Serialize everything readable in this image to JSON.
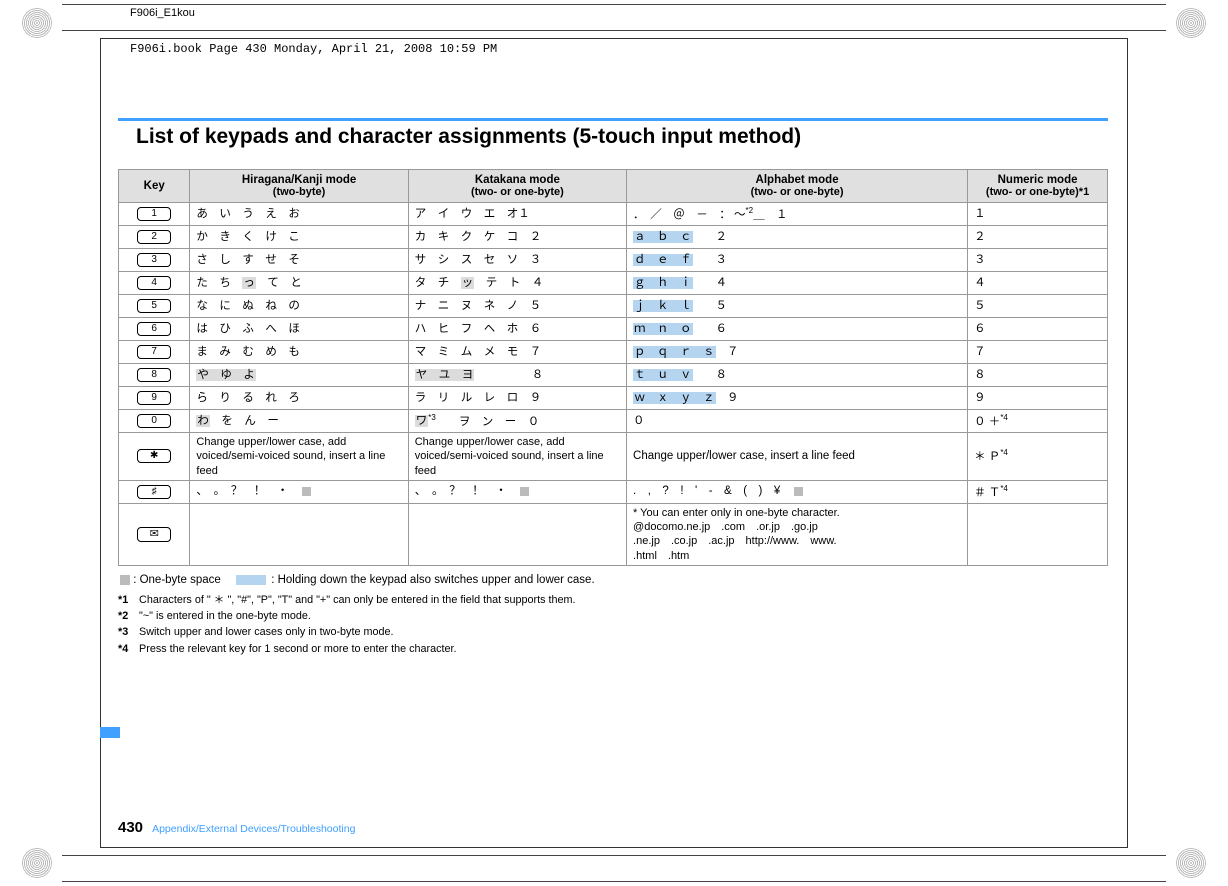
{
  "header_text": "F906i_E1kou",
  "book_info": "F906i.book  Page 430  Monday, April 21, 2008  10:59 PM",
  "title": "List of keypads and character assignments (5-touch input method)",
  "columns": {
    "key": "Key",
    "hiragana_title": "Hiragana/Kanji mode",
    "hiragana_sub": "(two-byte)",
    "katakana_title": "Katakana mode",
    "katakana_sub": "(two- or one-byte)",
    "alphabet_title": "Alphabet mode",
    "alphabet_sub": "(two- or one-byte)",
    "numeric_title": "Numeric mode",
    "numeric_sub": "(two- or one-byte)*1"
  },
  "rows": [
    {
      "key": "1",
      "hiragana": "あ　い　う　え　お",
      "katakana_a": "ア　イ　ウ　エ　オ",
      "katakana_b": "１",
      "alpha_a": "．　／　＠　－　：",
      "alpha_asterisk": "～",
      "alpha_sup": "*2",
      "alpha_b": "＿　１",
      "numeric": "１"
    },
    {
      "key": "2",
      "hiragana": "か　き　く　け　こ",
      "katakana_a": "カ　キ　ク　ケ　コ　２",
      "alpha_hl": "ａ　ｂ　ｃ",
      "alpha_b": "　　２",
      "numeric": "２"
    },
    {
      "key": "3",
      "hiragana": "さ　し　す　せ　そ",
      "katakana_a": "サ　シ　ス　セ　ソ　３",
      "alpha_hl": "ｄ　ｅ　ｆ",
      "alpha_b": "　　３",
      "numeric": "３"
    },
    {
      "key": "4",
      "hiragana": "た　ち　",
      "hiragana_sm": "っ",
      "hiragana_c": "　て　と",
      "katakana_a": "タ　チ　",
      "katakana_sm": "ッ",
      "katakana_c": "　テ　ト　４",
      "alpha_hl": "ｇ　ｈ　ｉ",
      "alpha_b": "　　４",
      "numeric": "４"
    },
    {
      "key": "5",
      "hiragana": "な　に　ぬ　ね　の",
      "katakana_a": "ナ　ニ　ヌ　ネ　ノ　５",
      "alpha_hl": "ｊ　ｋ　ｌ",
      "alpha_b": "　　５",
      "numeric": "５"
    },
    {
      "key": "6",
      "hiragana": "は　ひ　ふ　へ　ほ",
      "katakana_a": "ハ　ヒ　フ　ヘ　ホ　６",
      "alpha_hl": "ｍ　ｎ　ｏ",
      "alpha_b": "　　６",
      "numeric": "６"
    },
    {
      "key": "7",
      "hiragana": "ま　み　む　め　も",
      "katakana_a": "マ　ミ　ム　メ　モ　７",
      "alpha_hl": "ｐ　ｑ　ｒ　ｓ",
      "alpha_b": "　７",
      "numeric": "７"
    },
    {
      "key": "8",
      "hiragana_sm": "や　ゆ　よ",
      "katakana_sm": "ヤ　ユ　ヨ",
      "katakana_b": "　　　　　８",
      "alpha_hl": "ｔ　ｕ　ｖ",
      "alpha_b": "　　８",
      "numeric": "８"
    },
    {
      "key": "9",
      "hiragana": "ら　り　る　れ　ろ",
      "katakana_a": "ラ　リ　ル　レ　ロ　９",
      "alpha_hl": "ｗ　ｘ　ｙ　ｚ",
      "alpha_b": "　９",
      "numeric": "９"
    },
    {
      "key": "0",
      "hiragana_sm": "わ",
      "hiragana_c": "　を　ん　ー",
      "katakana_sm": "ワ",
      "katakana_sup": "*3",
      "katakana_c": "　　ヲ　ン　ー　０",
      "alpha_a": "０",
      "numeric": "０ ＋",
      "numeric_sup": "*4"
    },
    {
      "key": "*",
      "hiragana": "Change upper/lower case, add voiced/semi-voiced sound, insert a line feed",
      "katakana_a": "Change upper/lower case, add voiced/semi-voiced sound, insert a line feed",
      "alpha_a": "Change upper/lower case, insert a line feed",
      "numeric": "＊ Ｐ",
      "numeric_sup": "*4",
      "multiline": true
    },
    {
      "key": "#",
      "hiragana": "、　。　？　！　・",
      "hiragana_gray": true,
      "katakana_a": "、　。　？　！　・",
      "katakana_gray": true,
      "alpha_a": ".　,　?　!　'　-　&　(　)　¥",
      "alpha_gray": true,
      "numeric": "＃ Ｔ",
      "numeric_sup": "*4"
    }
  ],
  "mail_row": {
    "alpha_note_line1": "* You can enter only in one-byte character.",
    "alpha_note_line2": "@docomo.ne.jp　.com　.or.jp　.go.jp",
    "alpha_note_line3": ".ne.jp　.co.jp　.ac.jp　http://www.　www.",
    "alpha_note_line4": ".html　.htm"
  },
  "legend": {
    "one_byte": ": One-byte space",
    "holding": ": Holding down the keypad also switches upper and lower case."
  },
  "notes": {
    "n1_label": "*1",
    "n1": "Characters of \" ＊ \", \"#\", \"P\", \"T\" and \"+\" can only be entered in the field that supports them.",
    "n2_label": "*2",
    "n2": "\"~\" is entered in the one-byte mode.",
    "n3_label": "*3",
    "n3": "Switch upper and lower cases only in two-byte mode.",
    "n4_label": "*4",
    "n4": "Press the relevant key for 1 second or more to enter the character."
  },
  "footer": {
    "page": "430",
    "section": "Appendix/External Devices/Troubleshooting"
  }
}
